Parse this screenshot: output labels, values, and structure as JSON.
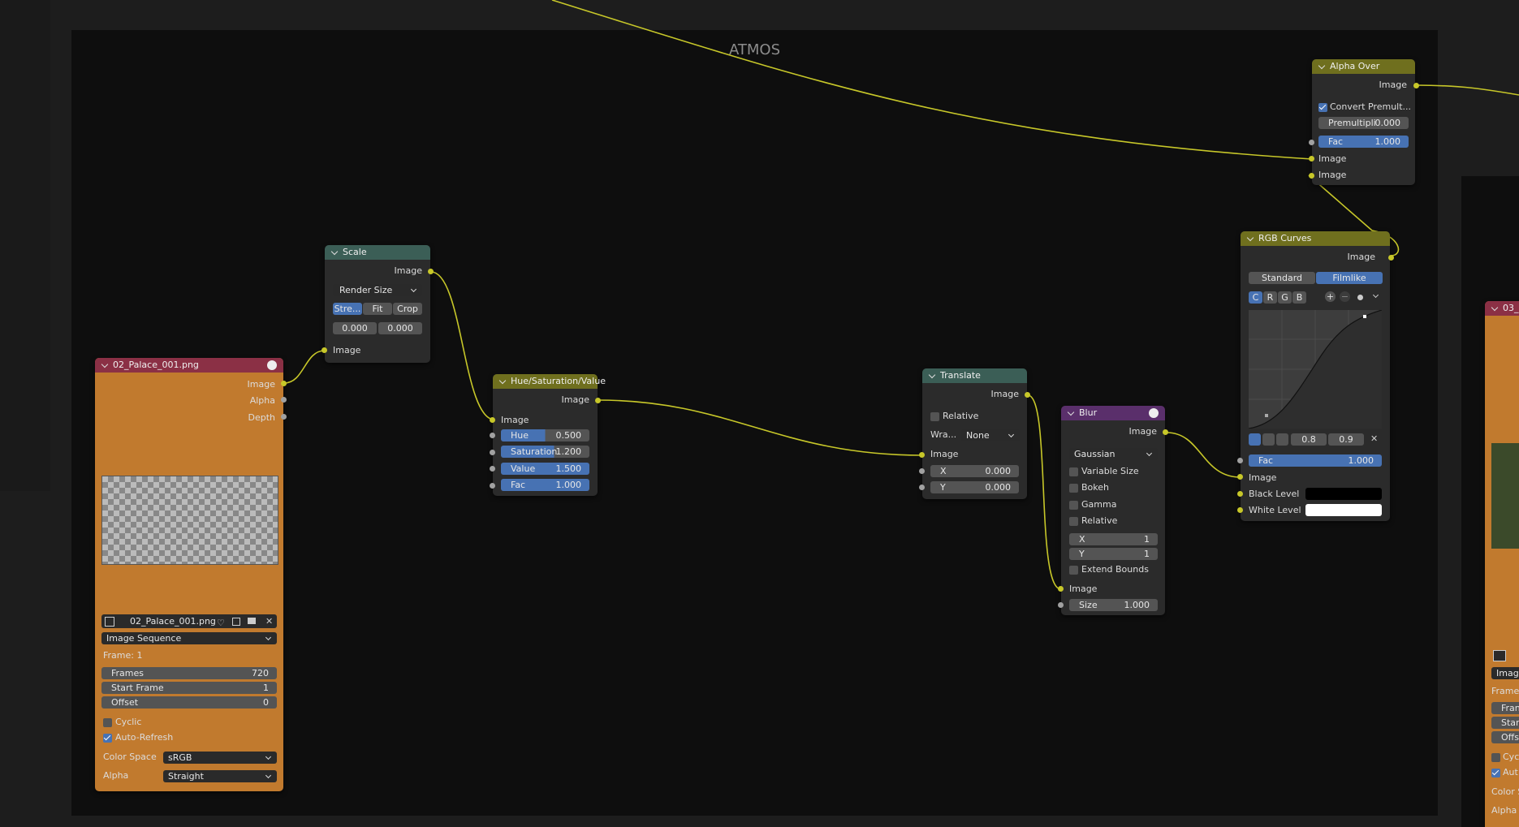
{
  "frame": {
    "label": "ATMOS"
  },
  "image_node": {
    "title": "02_Palace_001.png",
    "outputs": [
      "Image",
      "Alpha",
      "Depth"
    ],
    "filename": "02_Palace_001.png",
    "source": "Image Sequence",
    "frame_info": "Frame: 1",
    "frames_label": "Frames",
    "frames_value": "720",
    "start_label": "Start Frame",
    "start_value": "1",
    "offset_label": "Offset",
    "offset_value": "0",
    "cyclic": "Cyclic",
    "auto_refresh": "Auto-Refresh",
    "color_space_label": "Color Space",
    "color_space_value": "sRGB",
    "alpha_label": "Alpha",
    "alpha_value": "Straight"
  },
  "scale_node": {
    "title": "Scale",
    "output": "Image",
    "mode": "Render Size",
    "btn_stretch": "Stre...",
    "btn_fit": "Fit",
    "btn_crop": "Crop",
    "x": "0.000",
    "y": "0.000",
    "input": "Image"
  },
  "hsv_node": {
    "title": "Hue/Saturation/Value",
    "output": "Image",
    "input": "Image",
    "hue_label": "Hue",
    "hue_value": "0.500",
    "sat_label": "Saturation",
    "sat_value": "1.200",
    "val_label": "Value",
    "val_value": "1.500",
    "fac_label": "Fac",
    "fac_value": "1.000"
  },
  "translate_node": {
    "title": "Translate",
    "output": "Image",
    "relative": "Relative",
    "wrap_label": "Wra...",
    "wrap_value": "None",
    "input": "Image",
    "x_label": "X",
    "x_value": "0.000",
    "y_label": "Y",
    "y_value": "0.000"
  },
  "blur_node": {
    "title": "Blur",
    "output": "Image",
    "filter": "Gaussian",
    "variable_size": "Variable Size",
    "bokeh": "Bokeh",
    "gamma": "Gamma",
    "relative": "Relative",
    "x_label": "X",
    "x_value": "1",
    "y_label": "Y",
    "y_value": "1",
    "extend_bounds": "Extend Bounds",
    "input": "Image",
    "size_label": "Size",
    "size_value": "1.000"
  },
  "curves_node": {
    "title": "RGB Curves",
    "output": "Image",
    "tab_standard": "Standard",
    "tab_filmlike": "Filmlike",
    "ch_c": "C",
    "ch_r": "R",
    "ch_g": "G",
    "ch_b": "B",
    "v1": "0.8",
    "v2": "0.9",
    "fac_label": "Fac",
    "fac_value": "1.000",
    "input": "Image",
    "black_level": "Black Level",
    "white_level": "White Level"
  },
  "alpha_node": {
    "title": "Alpha Over",
    "output": "Image",
    "convert": "Convert Premult...",
    "premul_label": "Premultipli",
    "premul_value": "0.000",
    "fac_label": "Fac",
    "fac_value": "1.000",
    "input1": "Image",
    "input2": "Image"
  },
  "right_node": {
    "title": "03_(",
    "image": "Image",
    "frame": "Frame:",
    "fran": "Fran",
    "star": "Star",
    "offs": "Offs",
    "cyc": "Cyc",
    "aut": "Aut",
    "color_s": "Color S",
    "alpha": "Alpha"
  },
  "colors": {
    "yellow_socket": "#c7c729",
    "image_header": "#8b3045",
    "vector_header": "#3b5e56",
    "color_header": "#6f6f1e",
    "filter_header": "#5a2f6b"
  }
}
